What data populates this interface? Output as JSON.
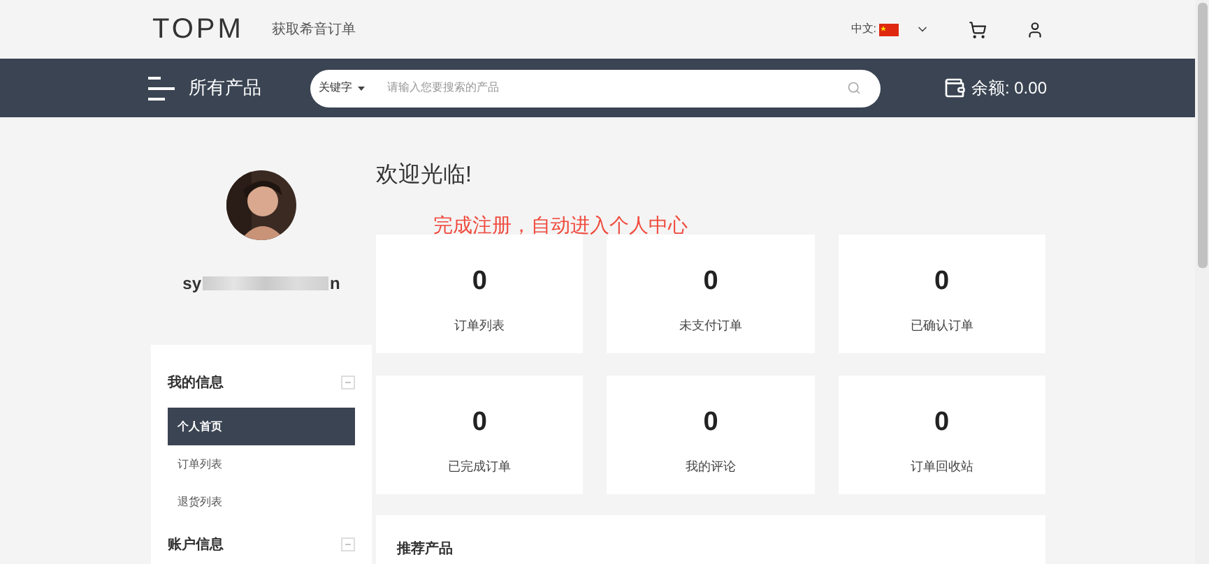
{
  "header": {
    "logo": "TOPM",
    "tagline": "获取希音订单",
    "language": "中文:"
  },
  "nav": {
    "menu_label": "所有产品",
    "search_type": "关键字",
    "search_placeholder": "请输入您要搜索的产品",
    "balance": "余额: 0.00"
  },
  "profile": {
    "username_start": "sy",
    "username_end": "n"
  },
  "sidebar": {
    "sections": [
      {
        "title": "我的信息",
        "expanded": true,
        "items": [
          {
            "label": "个人首页",
            "selected": true
          },
          {
            "label": "订单列表",
            "selected": false
          },
          {
            "label": "退货列表",
            "selected": false
          }
        ]
      },
      {
        "title": "账户信息",
        "expanded": true
      }
    ]
  },
  "main": {
    "welcome": "欢迎光临!",
    "annotation": "完成注册，自动进入个人中心",
    "stats": [
      {
        "value": "0",
        "label": "订单列表"
      },
      {
        "value": "0",
        "label": "未支付订单"
      },
      {
        "value": "0",
        "label": "已确认订单"
      },
      {
        "value": "0",
        "label": "已完成订单"
      },
      {
        "value": "0",
        "label": "我的评论"
      },
      {
        "value": "0",
        "label": "订单回收站"
      }
    ],
    "recommended_title": "推荐产品"
  }
}
